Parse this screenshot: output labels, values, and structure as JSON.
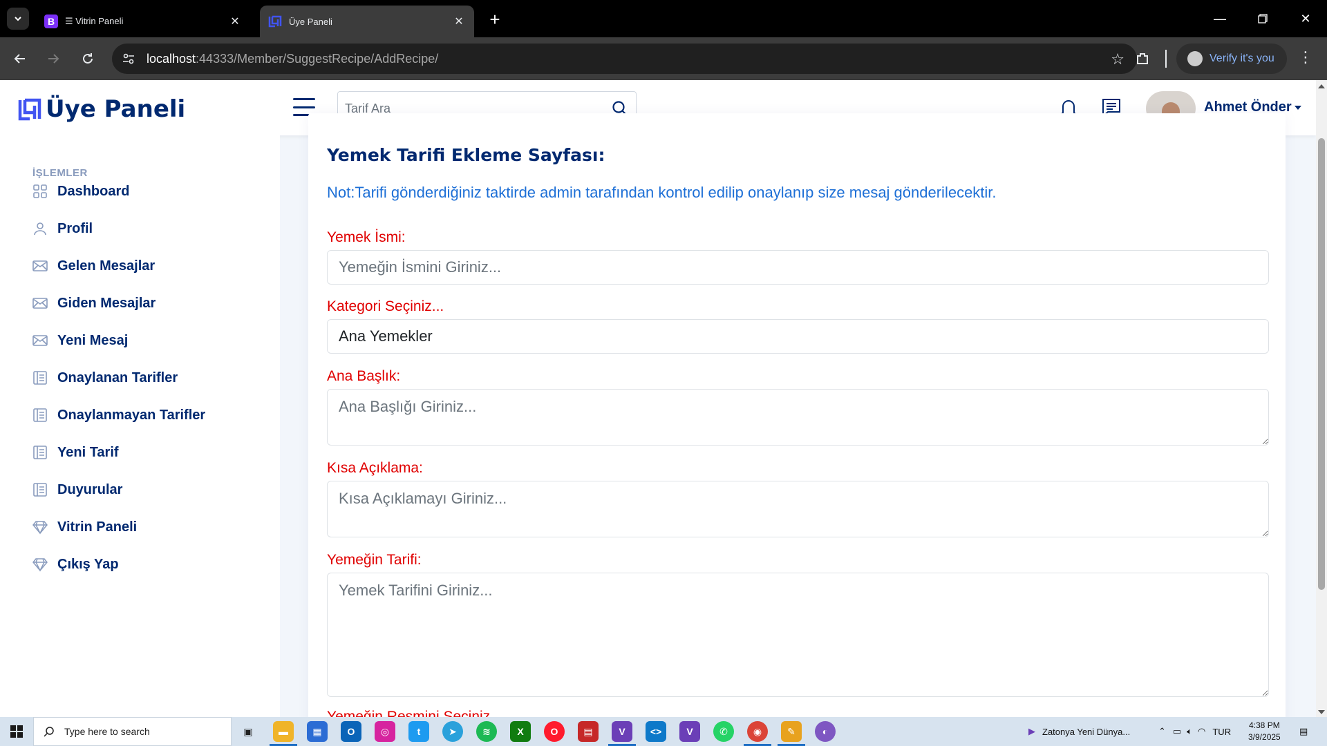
{
  "browser": {
    "tabs": [
      {
        "title": "☰ Vitrin Paneli",
        "favicon_letter": "B",
        "favicon_color": "#7b2ff7",
        "active": false
      },
      {
        "title": "Üye Paneli",
        "favicon_letter": "",
        "favicon_color": "#4154f1",
        "active": true
      }
    ],
    "url_host": "localhost",
    "url_rest": ":44333/Member/SuggestRecipe/AddRecipe/",
    "verify_label": "Verify it's you"
  },
  "header": {
    "logo_text": "Üye Paneli",
    "search_placeholder": "Tarif Ara",
    "user_name": "Ahmet Önder"
  },
  "sidebar": {
    "heading": "İŞLEMLER",
    "items": [
      {
        "label": "Dashboard",
        "icon": "grid-icon"
      },
      {
        "label": "Profil",
        "icon": "person-icon"
      },
      {
        "label": "Gelen Mesajlar",
        "icon": "envelope-icon"
      },
      {
        "label": "Giden Mesajlar",
        "icon": "envelope-icon"
      },
      {
        "label": "Yeni Mesaj",
        "icon": "envelope-icon"
      },
      {
        "label": "Onaylanan Tarifler",
        "icon": "layout-text-icon"
      },
      {
        "label": "Onaylanmayan Tarifler",
        "icon": "layout-text-icon"
      },
      {
        "label": "Yeni Tarif",
        "icon": "layout-text-icon"
      },
      {
        "label": "Duyurular",
        "icon": "layout-text-icon"
      },
      {
        "label": "Vitrin Paneli",
        "icon": "gem-icon"
      },
      {
        "label": "Çıkış Yap",
        "icon": "gem-icon"
      }
    ]
  },
  "form": {
    "title": "Yemek Tarifi Ekleme Sayfası:",
    "note": "Not:Tarifi gönderdiğiniz taktirde admin tarafından kontrol edilip onaylanıp size mesaj gönderilecektir.",
    "name_label": "Yemek İsmi:",
    "name_placeholder": "Yemeğin İsmini Giriniz...",
    "category_label": "Kategori Seçiniz...",
    "category_value": "Ana Yemekler",
    "heading_label": "Ana Başlık:",
    "heading_placeholder": "Ana Başlığı Giriniz...",
    "short_desc_label": "Kısa Açıklama:",
    "short_desc_placeholder": "Kısa Açıklamayı Giriniz...",
    "recipe_label": "Yemeğin Tarifi:",
    "recipe_placeholder": "Yemek Tarifini Giriniz...",
    "image_label_partial": "Yemeğin Resmini Seçiniz"
  },
  "taskbar": {
    "search_placeholder": "Type here to search",
    "media_title": "Zatonya Yeni Dünya...",
    "language": "TUR",
    "time": "4:38 PM",
    "date": "3/9/2025"
  },
  "colors": {
    "brand": "#012970",
    "label_red": "#e00000",
    "note_blue": "#1d6fd6"
  }
}
